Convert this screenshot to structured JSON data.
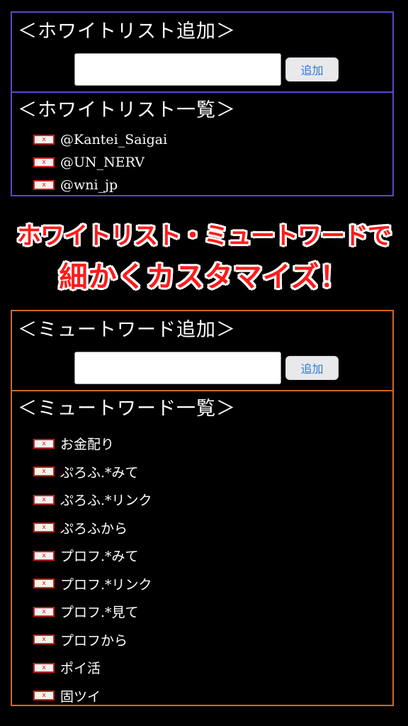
{
  "whitelist_add": {
    "title": "＜ホワイトリスト追加＞",
    "input_value": "",
    "button_label": "追加"
  },
  "whitelist_list": {
    "title": "＜ホワイトリスト一覧＞",
    "delete_label": "x",
    "items": [
      "@Kantei_Saigai",
      "@UN_NERV",
      "@wni_jp"
    ]
  },
  "promo": {
    "line1": "ホワイトリスト・ミュートワードで",
    "line2": "細かくカスタマイズ！"
  },
  "muteword_add": {
    "title": "＜ミュートワード追加＞",
    "input_value": "",
    "button_label": "追加"
  },
  "muteword_list": {
    "title": "＜ミュートワード一覧＞",
    "delete_label": "x",
    "items": [
      "お金配り",
      "ぷろふ.*みて",
      "ぷろふ.*リンク",
      "ぷろふから",
      "プロフ.*みて",
      "プロフ.*リンク",
      "プロフ.*見て",
      "プロフから",
      "ポイ活",
      "固ツイ"
    ]
  },
  "colors": {
    "background": "#000000",
    "whitelist_border": "#5a48c8",
    "muteword_border": "#d06a1c",
    "promo_text": "#ff1a1a",
    "add_button_text": "#2f7ad8",
    "delete_button": "#d31e1e"
  }
}
